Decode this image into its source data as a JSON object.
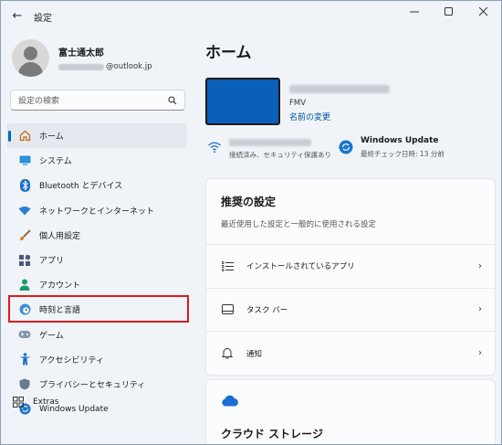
{
  "window": {
    "title": "設定",
    "back_icon": "arrow-left-icon",
    "controls": [
      "minimize-icon",
      "maximize-icon",
      "close-icon"
    ]
  },
  "profile": {
    "name": "富士通太郎",
    "email_suffix": "@outlook.jp"
  },
  "search": {
    "placeholder": "設定の検索",
    "icon": "search-icon"
  },
  "nav": {
    "items": [
      {
        "label": "ホーム",
        "icon": "home-icon",
        "active": true
      },
      {
        "label": "システム",
        "icon": "monitor-icon"
      },
      {
        "label": "Bluetooth とデバイス",
        "icon": "bluetooth-icon"
      },
      {
        "label": "ネットワークとインターネット",
        "icon": "network-icon"
      },
      {
        "label": "個人用設定",
        "icon": "brush-icon"
      },
      {
        "label": "アプリ",
        "icon": "apps-icon"
      },
      {
        "label": "アカウント",
        "icon": "account-icon"
      },
      {
        "label": "時刻と言語",
        "icon": "globe-clock-icon",
        "highlighted": true
      },
      {
        "label": "ゲーム",
        "icon": "gamepad-icon"
      },
      {
        "label": "アクセシビリティ",
        "icon": "accessibility-icon"
      },
      {
        "label": "プライバシーとセキュリティ",
        "icon": "shield-icon"
      },
      {
        "label": "Windows Update",
        "icon": "sync-icon"
      }
    ],
    "extras_label": "Extras",
    "highlight_color": "#e0181e",
    "accent_color": "#0067c0"
  },
  "main": {
    "title": "ホーム",
    "device": {
      "model": "FMV",
      "rename_link": "名前の変更"
    },
    "status": {
      "wifi_sub": "接続済み、セキュリティ保護あり",
      "update_title": "Windows Update",
      "update_sub": "最終チェック日時: 13 分前"
    },
    "recommended": {
      "title": "推奨の設定",
      "subtitle": "最近使用した設定と一般的に使用される設定",
      "rows": [
        {
          "label": "インストールされているアプリ",
          "icon": "list-icon"
        },
        {
          "label": "タスク バー",
          "icon": "taskbar-icon"
        },
        {
          "label": "通知",
          "icon": "bell-icon"
        }
      ]
    },
    "cloud": {
      "title": "クラウド ストレージ",
      "icon": "cloud-icon"
    }
  }
}
